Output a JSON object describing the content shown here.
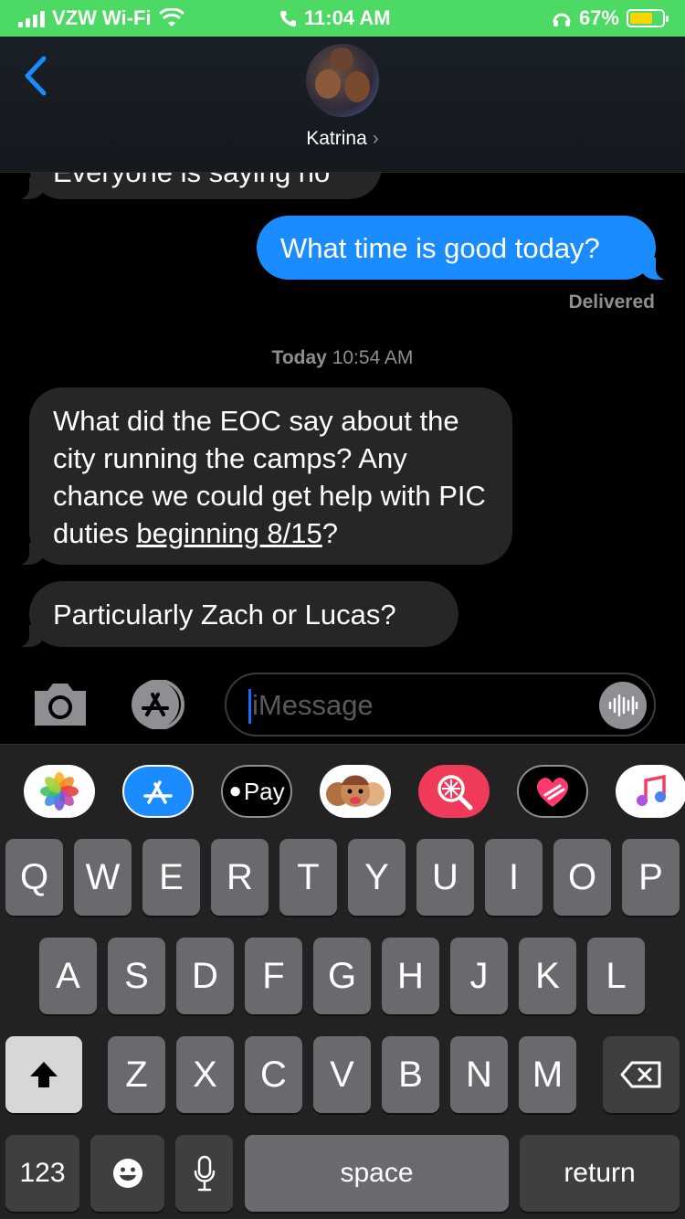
{
  "status": {
    "carrier": "VZW Wi-Fi",
    "time": "11:04 AM",
    "battery": "67%",
    "battery_level": 0.67
  },
  "header": {
    "contact_name": "Katrina",
    "chevron": "›"
  },
  "messages": {
    "partial": "Everyone is saying no",
    "outgoing": "What time is good today?",
    "delivered": "Delivered",
    "timestamp_day": "Today",
    "timestamp_time": "10:54 AM",
    "incoming1_part1": "What did the EOC say about the city running the camps? Any chance we could get help with PIC duties ",
    "incoming1_link": "beginning 8/15",
    "incoming1_part2": "?",
    "incoming2": "Particularly Zach or Lucas?"
  },
  "input": {
    "placeholder": "iMessage"
  },
  "app_drawer": {
    "apple_pay_label": "Pay",
    "icons": [
      "photos-icon",
      "app-store-icon",
      "apple-pay-icon",
      "memoji-icon",
      "search-images-icon",
      "digital-touch-icon",
      "music-icon"
    ]
  },
  "keyboard": {
    "row1": [
      "Q",
      "W",
      "E",
      "R",
      "T",
      "Y",
      "U",
      "I",
      "O",
      "P"
    ],
    "row2": [
      "A",
      "S",
      "D",
      "F",
      "G",
      "H",
      "J",
      "K",
      "L"
    ],
    "row3": [
      "Z",
      "X",
      "C",
      "V",
      "B",
      "N",
      "M"
    ],
    "numbers": "123",
    "space": "space",
    "return": "return"
  }
}
